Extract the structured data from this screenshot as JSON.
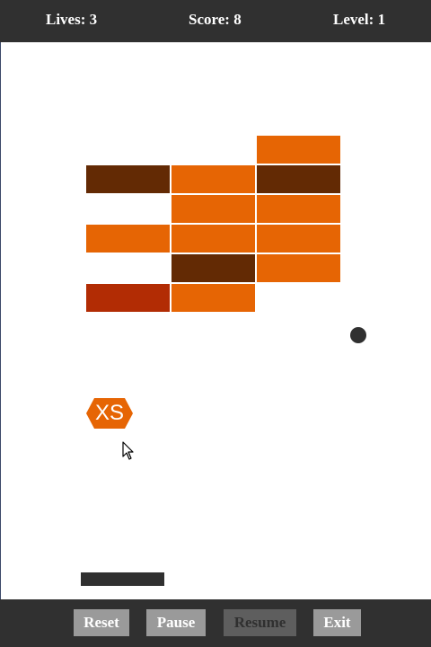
{
  "hud": {
    "lives_label": "Lives: 3",
    "score_label": "Score: 8",
    "level_label": "Level: 1",
    "lives": 3,
    "score": 8,
    "level": 1
  },
  "colors": {
    "bar": "#303030",
    "brick_orange": "#e66504",
    "brick_brown": "#632a04",
    "brick_red": "#b22c04",
    "ball": "#303030",
    "paddle": "#303030",
    "button": "#9a9a9a",
    "button_disabled": "#5e5e5e"
  },
  "bricks": [
    {
      "row": 0,
      "col": 2,
      "color": "brick_orange"
    },
    {
      "row": 1,
      "col": 0,
      "color": "brick_brown"
    },
    {
      "row": 1,
      "col": 1,
      "color": "brick_orange"
    },
    {
      "row": 1,
      "col": 2,
      "color": "brick_brown"
    },
    {
      "row": 2,
      "col": 1,
      "color": "brick_orange"
    },
    {
      "row": 2,
      "col": 2,
      "color": "brick_orange"
    },
    {
      "row": 3,
      "col": 0,
      "color": "brick_orange"
    },
    {
      "row": 3,
      "col": 1,
      "color": "brick_orange"
    },
    {
      "row": 3,
      "col": 2,
      "color": "brick_orange"
    },
    {
      "row": 4,
      "col": 1,
      "color": "brick_brown"
    },
    {
      "row": 4,
      "col": 2,
      "color": "brick_orange"
    },
    {
      "row": 5,
      "col": 0,
      "color": "brick_red"
    },
    {
      "row": 5,
      "col": 1,
      "color": "brick_orange"
    }
  ],
  "powerup": {
    "label": "XS",
    "icon": "hexagon-powerup-icon"
  },
  "cursor": {
    "icon": "mouse-pointer-icon"
  },
  "controls": {
    "reset_label": "Reset",
    "pause_label": "Pause",
    "resume_label": "Resume",
    "exit_label": "Exit",
    "resume_disabled": true
  }
}
